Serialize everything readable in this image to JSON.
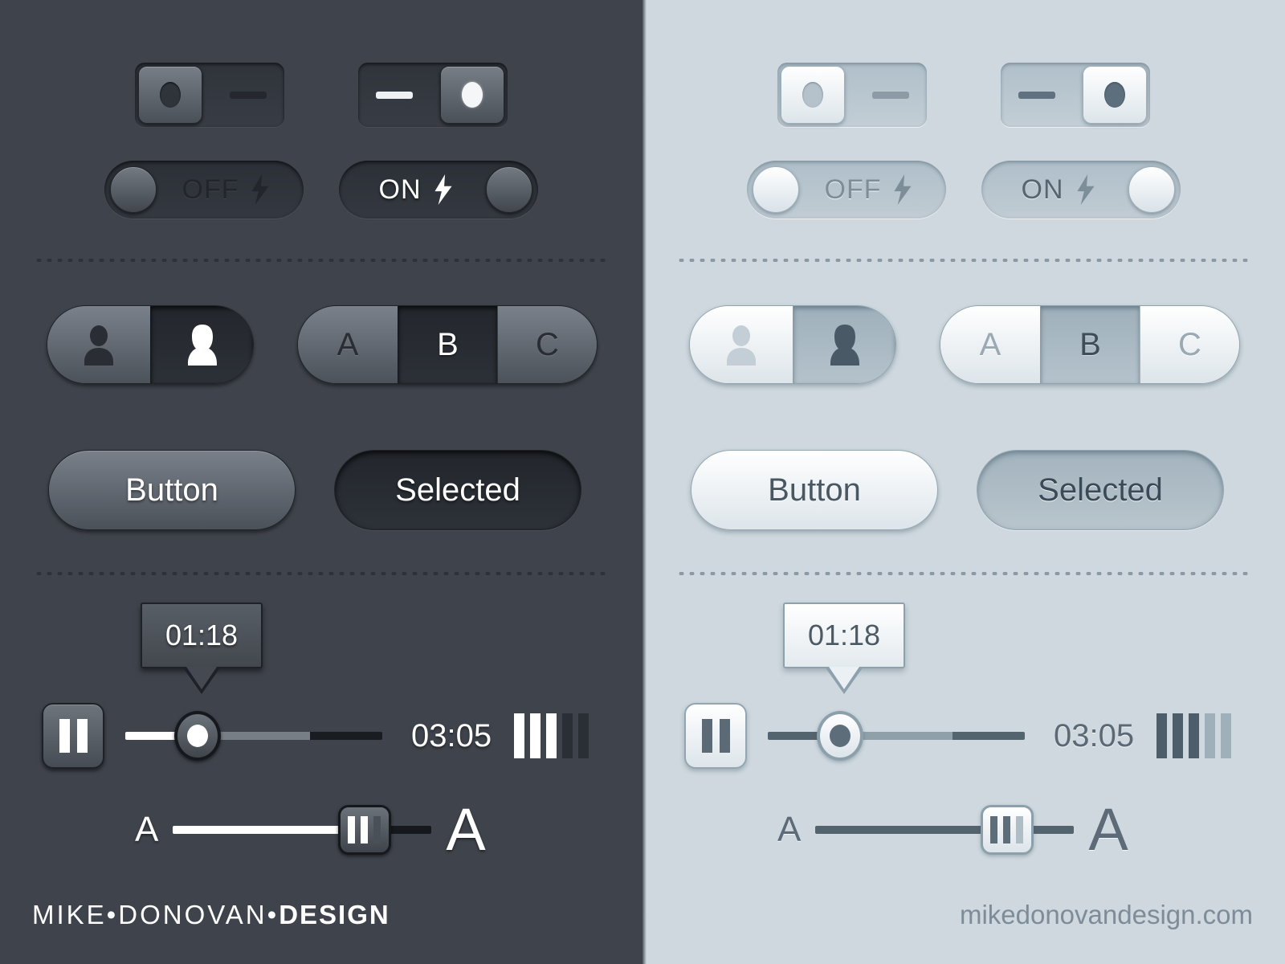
{
  "theme": {
    "dark_bg": "#3f444c",
    "light_bg": "#ced8de",
    "dark_accent": "#ffffff",
    "light_accent": "#54646f"
  },
  "switches": {
    "off": {
      "state_label": "off",
      "dot_icon": "circle-icon",
      "dash_icon": "dash-icon"
    },
    "on": {
      "state_label": "on",
      "dot_icon": "circle-icon",
      "dash_icon": "dash-icon"
    }
  },
  "pills": {
    "off": {
      "label": "OFF",
      "icon": "lightning-bolt-icon"
    },
    "on": {
      "label": "ON",
      "icon": "lightning-bolt-icon"
    }
  },
  "segments": {
    "people": [
      {
        "label": "",
        "icon": "person-male-icon",
        "selected": false
      },
      {
        "label": "",
        "icon": "person-female-icon",
        "selected": true
      }
    ],
    "letters": [
      {
        "label": "A",
        "selected": false
      },
      {
        "label": "B",
        "selected": true
      },
      {
        "label": "C",
        "selected": false
      }
    ]
  },
  "buttons": [
    {
      "label": "Button",
      "selected": false
    },
    {
      "label": "Selected",
      "selected": true
    }
  ],
  "player": {
    "tooltip_time": "01:18",
    "total_time": "03:05",
    "pause_icon": "pause-icon",
    "progress_percent": 28,
    "buffer_percent": 72,
    "volume": {
      "total_bars": 5,
      "active_bars": 3
    }
  },
  "text_size_slider": {
    "small_label": "A",
    "large_label": "A",
    "value_percent": 74,
    "handle_icon": "grip-lines-icon"
  },
  "footer": {
    "dark_brand_light": "MIKE•DONOVAN•",
    "dark_brand_bold": "DESIGN",
    "light_url": "mikedonovandesign.com"
  }
}
